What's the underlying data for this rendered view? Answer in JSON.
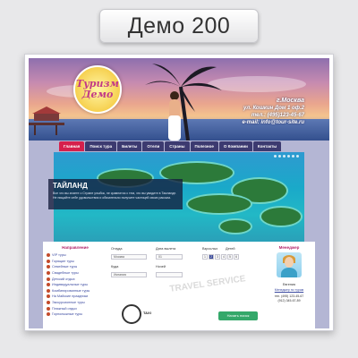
{
  "badge": {
    "label": "Демо 200"
  },
  "header": {
    "logo_line1": "Туризм",
    "logo_line2": "Демо",
    "city": "г.Москва",
    "address": "ул. Кошкин Дом 1 оф.2",
    "phone": "тел.: (495)123-45-67",
    "email": "e-mail: info@tour-site.ru"
  },
  "nav": {
    "items": [
      "Главная",
      "Поиск тура",
      "Билеты",
      "Отели",
      "Страны",
      "Полезное",
      "О Компании",
      "Контакты"
    ],
    "active_index": 0
  },
  "hero": {
    "title": "ТАЙЛАНД",
    "text": "Все что вы знаете о Стране улыбок, не сравнится с тем, что вы увидите в Таиланде. Не пищайте себе удовольствия и обязательно получите частицей своих рассказ."
  },
  "sidebar": {
    "heading": "Направление",
    "items": [
      "VIP туры",
      "Горящие туры",
      "Семейные туры",
      "Свадебные туры",
      "Детский отдых",
      "Индивидуальные туры",
      "Комбинированные туры",
      "На Майские праздники",
      "Экскурсионные туры",
      "Пляжный отдых",
      "Горнолыжные туры"
    ]
  },
  "search_form": {
    "labels": {
      "from": "Откуда",
      "date": "Дата вылета",
      "adults": "Взрослых",
      "children": "Детей",
      "country": "Куда",
      "nights": "Ночей"
    },
    "values": {
      "from": "Москва",
      "date": "01",
      "country": "Испания",
      "adults_nums": [
        "1",
        "2",
        "3",
        "4",
        "5",
        "6"
      ],
      "adults_selected": 1
    },
    "watermark": "TRAVEL SERVICE",
    "taxi": "TAXI",
    "submit": "Начать поиск"
  },
  "manager": {
    "heading": "Менеджер",
    "name": "Евгения",
    "role": "Менеджер по турам",
    "phone": "тел. (495) 123-45-67\n(912) 345-67-89"
  },
  "colors": {
    "nav_bg": "#3c3a70",
    "nav_active": "#d6204c",
    "accent_pink": "#b2246a",
    "submit": "#34a86a"
  }
}
